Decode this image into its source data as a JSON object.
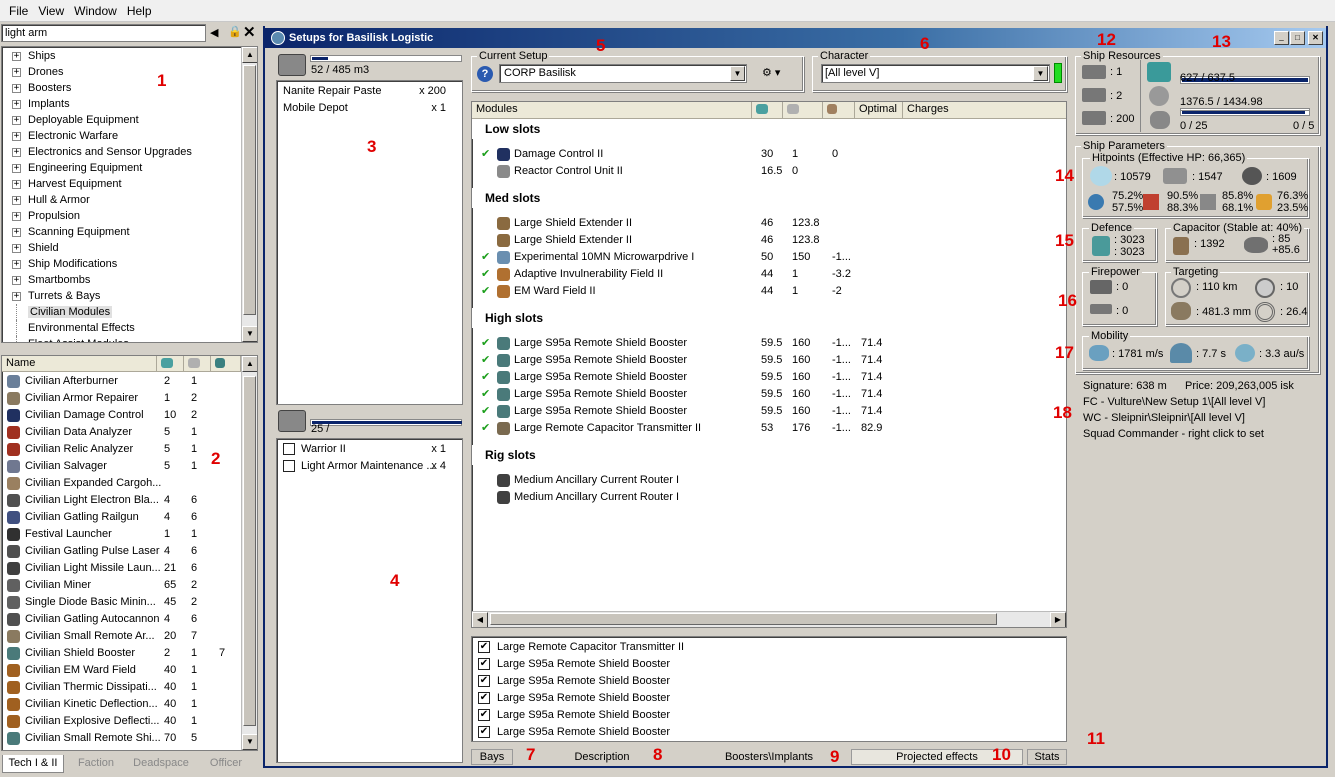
{
  "menu": [
    "File",
    "View",
    "Window",
    "Help"
  ],
  "search": {
    "value": "light arm"
  },
  "tree": [
    "Ships",
    "Drones",
    "Boosters",
    "Implants",
    "Deployable Equipment",
    "Electronic Warfare",
    "Electronics and Sensor Upgrades",
    "Engineering Equipment",
    "Harvest Equipment",
    "Hull & Armor",
    "Propulsion",
    "Scanning Equipment",
    "Shield",
    "Ship Modifications",
    "Smartbombs",
    "Turrets & Bays",
    "Civilian Modules",
    "Environmental Effects",
    "Fleet Assist Modules"
  ],
  "list_header": {
    "name": "Name"
  },
  "list_items": [
    {
      "n": "Civilian Afterburner",
      "a": "2",
      "b": "1",
      "c": "",
      "col": "#6a7f99"
    },
    {
      "n": "Civilian Armor Repairer",
      "a": "1",
      "b": "2",
      "c": "",
      "col": "#8a7a60"
    },
    {
      "n": "Civilian Damage Control",
      "a": "10",
      "b": "2",
      "c": "",
      "col": "#203060"
    },
    {
      "n": "Civilian Data Analyzer",
      "a": "5",
      "b": "1",
      "c": "",
      "col": "#a03020"
    },
    {
      "n": "Civilian Relic Analyzer",
      "a": "5",
      "b": "1",
      "c": "",
      "col": "#a03020"
    },
    {
      "n": "Civilian Salvager",
      "a": "5",
      "b": "1",
      "c": "",
      "col": "#707890"
    },
    {
      "n": "Civilian Expanded Cargoh...",
      "a": "",
      "b": "",
      "c": "",
      "col": "#9a8060"
    },
    {
      "n": "Civilian Light Electron Bla...",
      "a": "4",
      "b": "6",
      "c": "",
      "col": "#505050"
    },
    {
      "n": "Civilian Gatling Railgun",
      "a": "4",
      "b": "6",
      "c": "",
      "col": "#405080"
    },
    {
      "n": "Festival Launcher",
      "a": "1",
      "b": "1",
      "c": "",
      "col": "#303030"
    },
    {
      "n": "Civilian Gatling Pulse Laser",
      "a": "4",
      "b": "6",
      "c": "",
      "col": "#505050"
    },
    {
      "n": "Civilian Light Missile Laun...",
      "a": "21",
      "b": "6",
      "c": "",
      "col": "#404040"
    },
    {
      "n": "Civilian Miner",
      "a": "65",
      "b": "2",
      "c": "",
      "col": "#606060"
    },
    {
      "n": "Single Diode Basic Minin...",
      "a": "45",
      "b": "2",
      "c": "",
      "col": "#606060"
    },
    {
      "n": "Civilian Gatling Autocannon",
      "a": "4",
      "b": "6",
      "c": "",
      "col": "#505050"
    },
    {
      "n": "Civilian Small Remote Ar...",
      "a": "20",
      "b": "7",
      "c": "",
      "col": "#8a7a60"
    },
    {
      "n": "Civilian Shield Booster",
      "a": "2",
      "b": "1",
      "c": "7",
      "col": "#4a7a7a"
    },
    {
      "n": "Civilian EM Ward Field",
      "a": "40",
      "b": "1",
      "c": "",
      "col": "#a06020"
    },
    {
      "n": "Civilian Thermic Dissipati...",
      "a": "40",
      "b": "1",
      "c": "",
      "col": "#a06020"
    },
    {
      "n": "Civilian Kinetic Deflection...",
      "a": "40",
      "b": "1",
      "c": "",
      "col": "#a06020"
    },
    {
      "n": "Civilian Explosive Deflecti...",
      "a": "40",
      "b": "1",
      "c": "",
      "col": "#a06020"
    },
    {
      "n": "Civilian Small Remote Shi...",
      "a": "70",
      "b": "5",
      "c": "",
      "col": "#4a7a7a"
    }
  ],
  "bottom_tabs": [
    "Tech I & II",
    "Faction",
    "Deadspace",
    "Officer"
  ],
  "window": {
    "title": "Setups for Basilisk Logistic"
  },
  "cargo": {
    "capacity": "52 / 485 m3",
    "items": [
      {
        "n": "Nanite Repair Paste",
        "q": "x 200"
      },
      {
        "n": "Mobile Depot",
        "q": "x 1"
      }
    ],
    "fill": 0.107
  },
  "drones": {
    "capacity": "25 /",
    "items": [
      {
        "n": "Warrior II",
        "q": "x 1"
      },
      {
        "n": "Light Armor Maintenance ...",
        "q": "x 4"
      }
    ],
    "fill": 1.0
  },
  "setup": {
    "label": "Current Setup",
    "value": "CORP Basilisk"
  },
  "character": {
    "label": "Character",
    "value": "[All level V]"
  },
  "modules_header": {
    "modules": "Modules",
    "optimal": "Optimal",
    "charges": "Charges"
  },
  "sections": [
    {
      "title": "Low slots",
      "rows": [
        {
          "n": "Damage Control II",
          "v1": "30",
          "v2": "1",
          "v3": "0",
          "v4": "",
          "ok": true,
          "col": "#203060"
        },
        {
          "n": "Reactor Control Unit II",
          "v1": "16.5",
          "v2": "0",
          "v3": "",
          "v4": "",
          "ok": false,
          "col": "#8a8a8a"
        }
      ]
    },
    {
      "title": "Med slots",
      "rows": [
        {
          "n": "Large Shield Extender II",
          "v1": "46",
          "v2": "123.8",
          "v3": "",
          "v4": "",
          "ok": false,
          "col": "#8a6a40"
        },
        {
          "n": "Large Shield Extender II",
          "v1": "46",
          "v2": "123.8",
          "v3": "",
          "v4": "",
          "ok": false,
          "col": "#8a6a40"
        },
        {
          "n": "Experimental 10MN Microwarpdrive I",
          "v1": "50",
          "v2": "150",
          "v3": "-1...",
          "v4": "",
          "ok": true,
          "col": "#6a8fb0"
        },
        {
          "n": "Adaptive Invulnerability Field II",
          "v1": "44",
          "v2": "1",
          "v3": "-3.2",
          "v4": "",
          "ok": true,
          "col": "#b07030"
        },
        {
          "n": "EM Ward Field II",
          "v1": "44",
          "v2": "1",
          "v3": "-2",
          "v4": "",
          "ok": true,
          "col": "#b07030"
        }
      ]
    },
    {
      "title": "High slots",
      "rows": [
        {
          "n": "Large S95a Remote Shield Booster",
          "v1": "59.5",
          "v2": "160",
          "v3": "-1...",
          "v4": "71.4",
          "ok": true,
          "col": "#4a7a7a"
        },
        {
          "n": "Large S95a Remote Shield Booster",
          "v1": "59.5",
          "v2": "160",
          "v3": "-1...",
          "v4": "71.4",
          "ok": true,
          "col": "#4a7a7a"
        },
        {
          "n": "Large S95a Remote Shield Booster",
          "v1": "59.5",
          "v2": "160",
          "v3": "-1...",
          "v4": "71.4",
          "ok": true,
          "col": "#4a7a7a"
        },
        {
          "n": "Large S95a Remote Shield Booster",
          "v1": "59.5",
          "v2": "160",
          "v3": "-1...",
          "v4": "71.4",
          "ok": true,
          "col": "#4a7a7a"
        },
        {
          "n": "Large S95a Remote Shield Booster",
          "v1": "59.5",
          "v2": "160",
          "v3": "-1...",
          "v4": "71.4",
          "ok": true,
          "col": "#4a7a7a"
        },
        {
          "n": "Large Remote Capacitor Transmitter II",
          "v1": "53",
          "v2": "176",
          "v3": "-1...",
          "v4": "82.9",
          "ok": true,
          "col": "#7a6a50"
        }
      ]
    },
    {
      "title": "Rig slots",
      "rows": [
        {
          "n": "Medium Ancillary Current Router I",
          "v1": "",
          "v2": "",
          "v3": "",
          "v4": "",
          "ok": false,
          "col": "#404040"
        },
        {
          "n": "Medium Ancillary Current Router I",
          "v1": "",
          "v2": "",
          "v3": "",
          "v4": "",
          "ok": false,
          "col": "#404040"
        }
      ]
    }
  ],
  "checked_list": [
    "Large Remote Capacitor Transmitter II",
    "Large S95a Remote Shield Booster",
    "Large S95a Remote Shield Booster",
    "Large S95a Remote Shield Booster",
    "Large S95a Remote Shield Booster",
    "Large S95a Remote Shield Booster"
  ],
  "tabs": [
    "Bays",
    "Description",
    "Boosters\\Implants",
    "Projected effects",
    "Stats"
  ],
  "resources": {
    "title": "Ship Resources",
    "turret": ": 1",
    "launcher": ": 2",
    "calib": ": 200",
    "cpu": "627 / 637.5",
    "pg": "1376.5 / 1434.98",
    "drone": "0 / 25",
    "drone2": "0 / 5",
    "cpu_fill": 0.983,
    "pg_fill": 0.959
  },
  "params": {
    "title": "Ship Parameters",
    "hp_title": "Hitpoints (Effective HP: 66,365)",
    "shield": ": 10579",
    "armor": ": 1547",
    "hull": ": 1609",
    "res": [
      [
        "75.2%",
        "57.5%"
      ],
      [
        "90.5%",
        "88.3%"
      ],
      [
        "85.8%",
        "68.1%"
      ],
      [
        "76.3%",
        "23.5%"
      ]
    ],
    "def_title": "Defence",
    "def1": ": 3023",
    "def2": ": 3023",
    "cap_title": "Capacitor (Stable at: 40%)",
    "cap": ": 1392",
    "cap2": ": 85",
    "cap3": "+85.6",
    "fire_title": "Firepower",
    "fire1": ": 0",
    "fire2": ": 0",
    "tgt_title": "Targeting",
    "t1": ": 110 km",
    "t2": ": 10",
    "t3": ": 481.3 mm",
    "t4": ": 26.4",
    "mob_title": "Mobility",
    "speed": ": 1781 m/s",
    "align": ": 7.7 s",
    "warp": ": 3.3 au/s"
  },
  "info": {
    "sig": "Signature: 638 m",
    "price": "Price: 209,263,005 isk",
    "fc": "FC - Vulture\\New Setup 1\\[All level V]",
    "wc": "WC - Sleipnir\\Sleipnir\\[All level V]",
    "sq": "Squad Commander - right click to set"
  },
  "annotations": [
    "1",
    "2",
    "3",
    "4",
    "5",
    "6",
    "7",
    "8",
    "9",
    "10",
    "11",
    "12",
    "13",
    "14",
    "15",
    "16",
    "17",
    "18"
  ]
}
